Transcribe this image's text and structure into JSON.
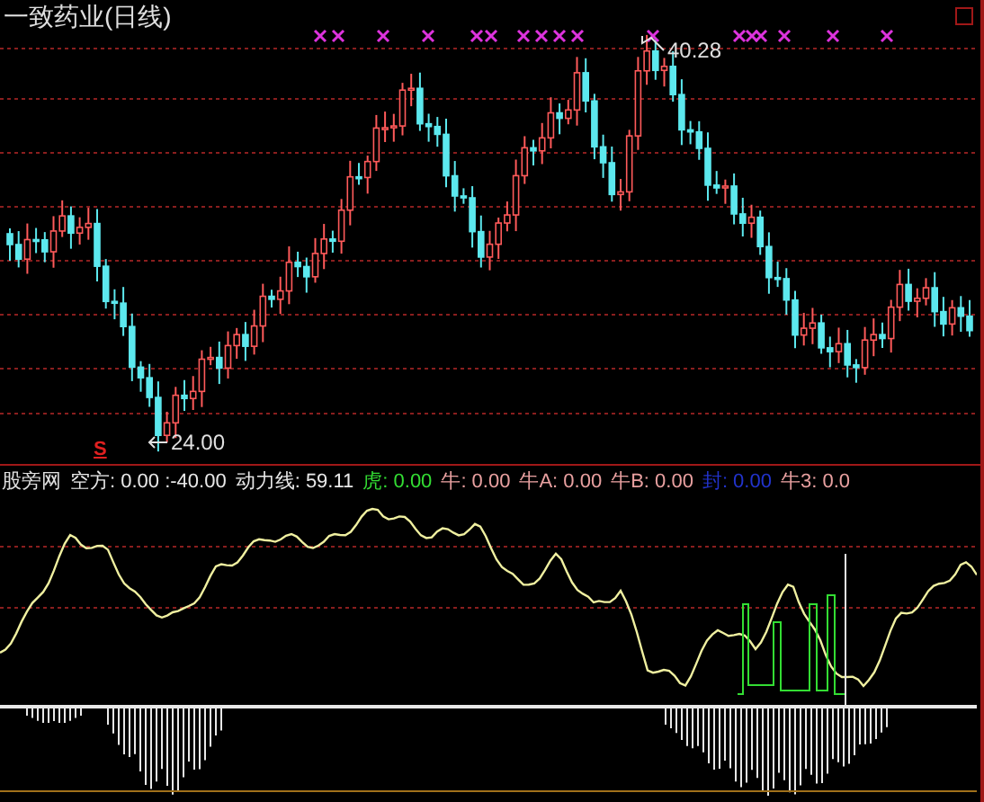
{
  "title": "一致药业(日线)",
  "price_labels": {
    "high": "40.28",
    "low": "24.00"
  },
  "signal_label": "S",
  "indicator": {
    "name": "股旁网",
    "readings": [
      {
        "text": "空方: 0.00 :-40.00",
        "color": "#e8e8e8"
      },
      {
        "text": "动力线: 59.11",
        "color": "#e8e8e8"
      },
      {
        "text": "虎: 0.00",
        "color": "#33dd33"
      },
      {
        "text": "牛: 0.00",
        "color": "#e8a0a0"
      },
      {
        "text": "牛A: 0.00",
        "color": "#e8a0a0"
      },
      {
        "text": "牛B: 0.00",
        "color": "#e8a0a0"
      },
      {
        "text": "封: 0.00",
        "color": "#2233cc"
      },
      {
        "text": "牛3: 0.0",
        "color": "#e8a0a0"
      }
    ]
  }
}
